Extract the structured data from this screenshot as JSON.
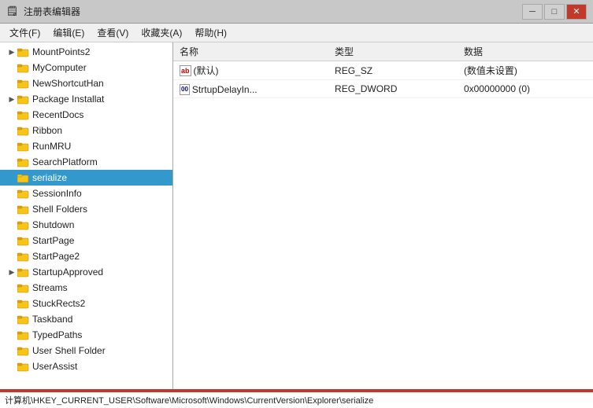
{
  "titleBar": {
    "title": "注册表编辑器",
    "iconUnicode": "🗒",
    "minimizeLabel": "─",
    "maximizeLabel": "□",
    "closeLabel": "✕"
  },
  "menuBar": {
    "items": [
      {
        "label": "文件(F)"
      },
      {
        "label": "编辑(E)"
      },
      {
        "label": "查看(V)"
      },
      {
        "label": "收藏夹(A)"
      },
      {
        "label": "帮助(H)"
      }
    ]
  },
  "treePanel": {
    "items": [
      {
        "id": "MountPoints2",
        "label": "MountPoints2",
        "indent": 1,
        "hasExpand": true,
        "expandChar": "▶"
      },
      {
        "id": "MyComputer",
        "label": "MyComputer",
        "indent": 1,
        "hasExpand": false,
        "expandChar": ""
      },
      {
        "id": "NewShortcutHan",
        "label": "NewShortcutHan",
        "indent": 1,
        "hasExpand": false,
        "expandChar": ""
      },
      {
        "id": "Package Installat",
        "label": "Package Installat",
        "indent": 1,
        "hasExpand": true,
        "expandChar": "▶"
      },
      {
        "id": "RecentDocs",
        "label": "RecentDocs",
        "indent": 1,
        "hasExpand": false,
        "expandChar": ""
      },
      {
        "id": "Ribbon",
        "label": "Ribbon",
        "indent": 1,
        "hasExpand": false,
        "expandChar": ""
      },
      {
        "id": "RunMRU",
        "label": "RunMRU",
        "indent": 1,
        "hasExpand": false,
        "expandChar": ""
      },
      {
        "id": "SearchPlatform",
        "label": "SearchPlatform",
        "indent": 1,
        "hasExpand": false,
        "expandChar": ""
      },
      {
        "id": "serialize",
        "label": "serialize",
        "indent": 1,
        "hasExpand": false,
        "expandChar": "",
        "selected": true
      },
      {
        "id": "SessionInfo",
        "label": "SessionInfo",
        "indent": 1,
        "hasExpand": false,
        "expandChar": ""
      },
      {
        "id": "Shell Folders",
        "label": "Shell Folders",
        "indent": 1,
        "hasExpand": false,
        "expandChar": ""
      },
      {
        "id": "Shutdown",
        "label": "Shutdown",
        "indent": 1,
        "hasExpand": false,
        "expandChar": ""
      },
      {
        "id": "StartPage",
        "label": "StartPage",
        "indent": 1,
        "hasExpand": false,
        "expandChar": ""
      },
      {
        "id": "StartPage2",
        "label": "StartPage2",
        "indent": 1,
        "hasExpand": false,
        "expandChar": ""
      },
      {
        "id": "StartupApproved",
        "label": "StartupApproved",
        "indent": 1,
        "hasExpand": true,
        "expandChar": "▶"
      },
      {
        "id": "Streams",
        "label": "Streams",
        "indent": 1,
        "hasExpand": false,
        "expandChar": ""
      },
      {
        "id": "StuckRects2",
        "label": "StuckRects2",
        "indent": 1,
        "hasExpand": false,
        "expandChar": ""
      },
      {
        "id": "Taskband",
        "label": "Taskband",
        "indent": 1,
        "hasExpand": false,
        "expandChar": ""
      },
      {
        "id": "TypedPaths",
        "label": "TypedPaths",
        "indent": 1,
        "hasExpand": false,
        "expandChar": ""
      },
      {
        "id": "User Shell Folder",
        "label": "User Shell Folder",
        "indent": 1,
        "hasExpand": false,
        "expandChar": ""
      },
      {
        "id": "UserAssist",
        "label": "UserAssist",
        "indent": 1,
        "hasExpand": false,
        "expandChar": ""
      }
    ]
  },
  "rightPanel": {
    "columns": [
      "名称",
      "类型",
      "数据"
    ],
    "rows": [
      {
        "nameIcon": "ab",
        "name": "(默认)",
        "type": "REG_SZ",
        "data": "(数值未设置)"
      },
      {
        "nameIcon": "dword",
        "name": "StrtupDelayIn...",
        "type": "REG_DWORD",
        "data": "0x00000000 (0)"
      }
    ]
  },
  "statusBar": {
    "text": "计算机\\HKEY_CURRENT_USER\\Software\\Microsoft\\Windows\\CurrentVersion\\Explorer\\serialize"
  }
}
